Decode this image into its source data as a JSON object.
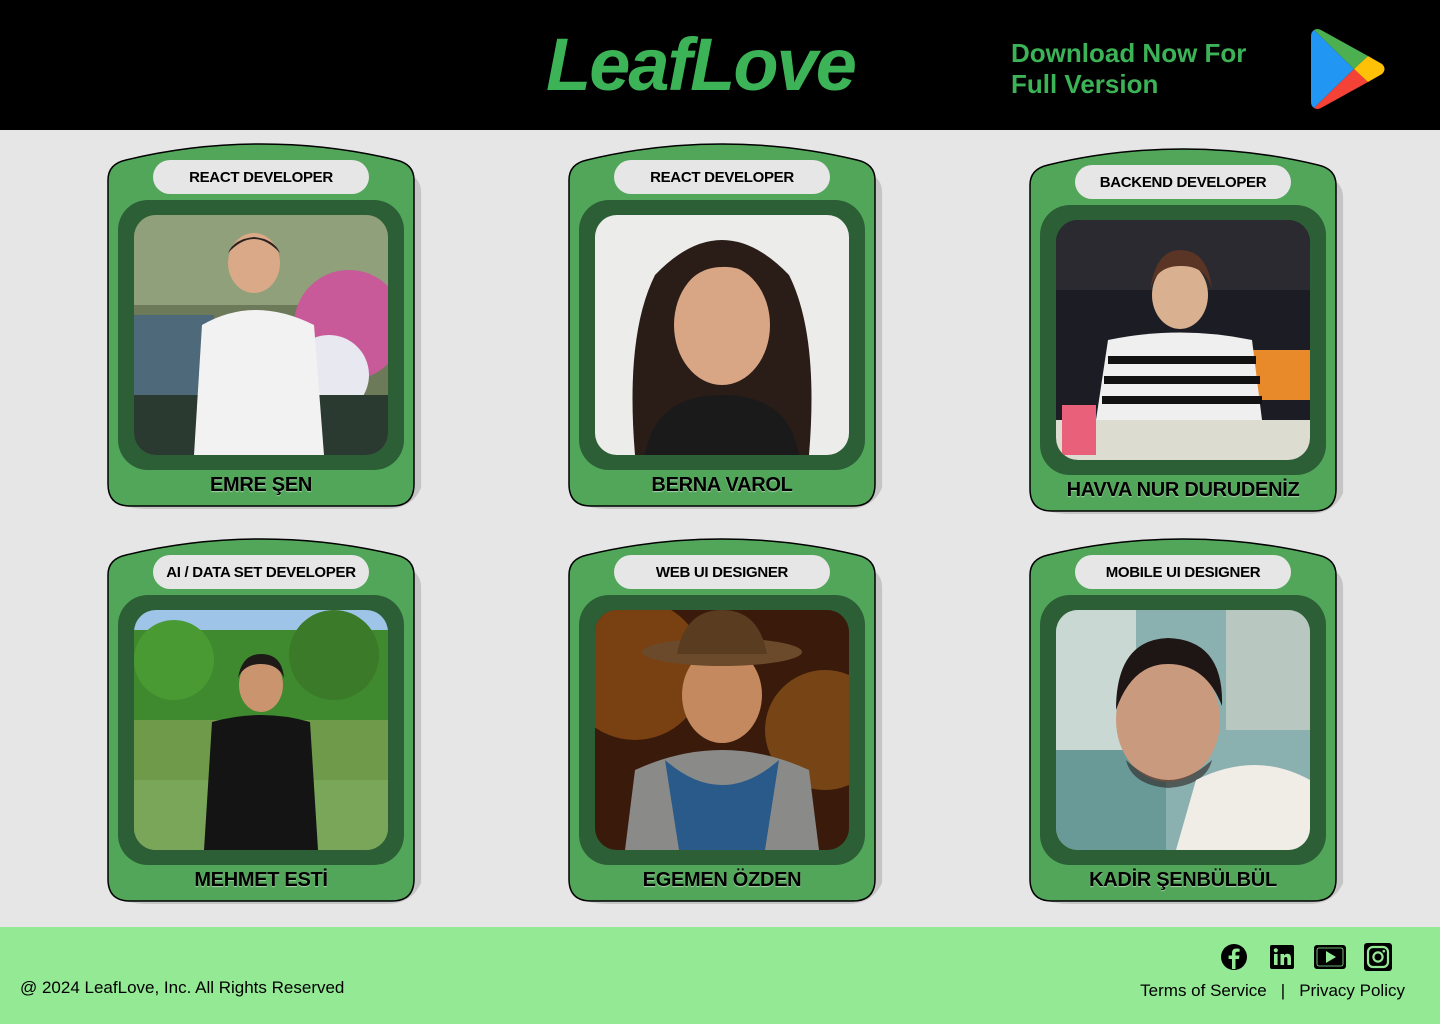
{
  "header": {
    "logo": "LeafLove",
    "download_text": "Download Now For Full Version",
    "store_icon": "google-play-icon"
  },
  "colors": {
    "header_bg": "#000000",
    "brand_green": "#3cb356",
    "card_green": "#52a65a",
    "frame_dark_green": "#2c5f35",
    "page_bg": "#e6e6e6",
    "footer_bg": "#93e994"
  },
  "team": [
    {
      "role": "REACT DEVELOPER",
      "name": "EMRE ŞEN"
    },
    {
      "role": "REACT DEVELOPER",
      "name": "BERNA VAROL"
    },
    {
      "role": "BACKEND DEVELOPER",
      "name": "HAVVA NUR DURUDENİZ"
    },
    {
      "role": "AI / DATA SET DEVELOPER",
      "name": "MEHMET ESTİ"
    },
    {
      "role": "WEB UI DESIGNER",
      "name": "EGEMEN ÖZDEN"
    },
    {
      "role": "MOBILE UI DESIGNER",
      "name": "KADİR ŞENBÜLBÜL"
    }
  ],
  "footer": {
    "copyright": "@ 2024 LeafLove, Inc. All Rights Reserved",
    "terms": "Terms of Service",
    "separator": "|",
    "privacy": "Privacy Policy",
    "social_icons": [
      "facebook-icon",
      "linkedin-icon",
      "youtube-icon",
      "instagram-icon"
    ]
  }
}
